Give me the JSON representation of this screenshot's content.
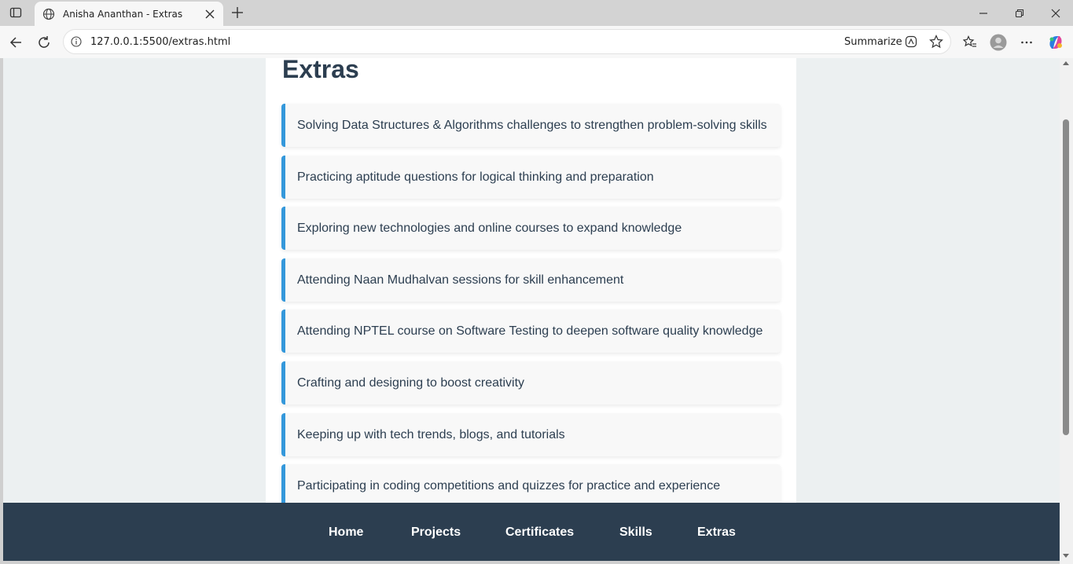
{
  "browser": {
    "tab_title": "Anisha Ananthan - Extras",
    "url": "127.0.0.1:5500/extras.html",
    "summarize_label": "Summarize"
  },
  "page": {
    "title": "Extras",
    "items": [
      "Solving Data Structures & Algorithms challenges to strengthen problem-solving skills",
      "Practicing aptitude questions for logical thinking and preparation",
      "Exploring new technologies and online courses to expand knowledge",
      "Attending Naan Mudhalvan sessions for skill enhancement",
      "Attending NPTEL course on Software Testing to deepen software quality knowledge",
      "Crafting and designing to boost creativity",
      "Keeping up with tech trends, blogs, and tutorials",
      "Participating in coding competitions and quizzes for practice and experience"
    ]
  },
  "nav": {
    "home": "Home",
    "projects": "Projects",
    "certificates": "Certificates",
    "skills": "Skills",
    "extras": "Extras"
  },
  "colors": {
    "accent": "#3498db",
    "heading": "#2c3e50",
    "footer_bg": "#2c3e50",
    "page_bg": "#ecf0f1"
  }
}
